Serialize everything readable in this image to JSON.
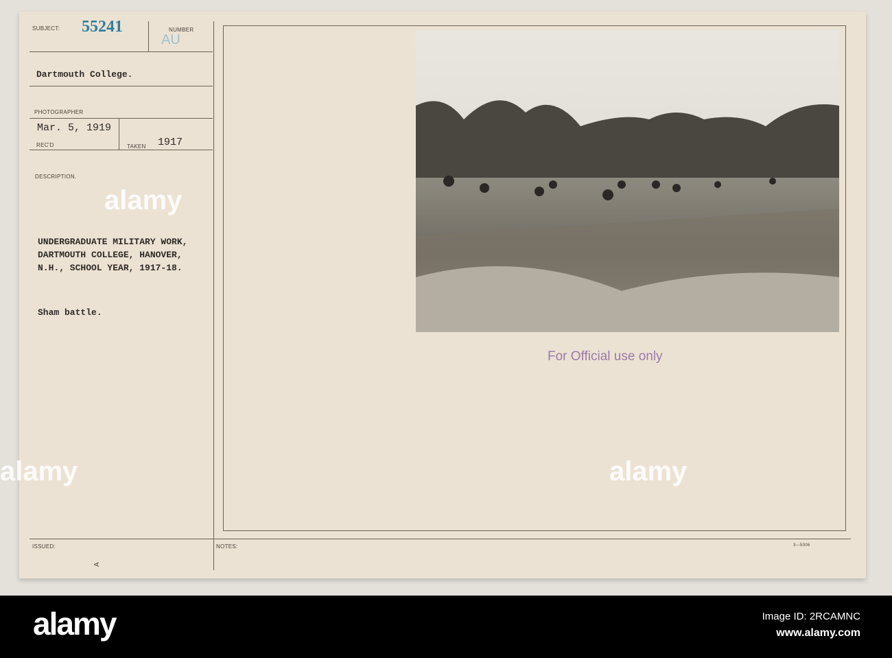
{
  "card": {
    "subject_label": "SUBJECT:",
    "subject_number": "55241",
    "number_label": "NUMBER",
    "number_value": "AU",
    "subject_text": "Dartmouth College.",
    "photographer_label": "PHOTOGRAPHER",
    "received_date": "Mar. 5, 1919",
    "recd_label": "REC'D",
    "taken_label": "TAKEN",
    "taken_year": "1917",
    "description_label": "DESCRIPTION.",
    "description_lines": [
      "UNDERGRADUATE MILITARY WORK,",
      "DARTMOUTH COLLEGE, HANOVER,",
      "N.H., SCHOOL YEAR, 1917-18."
    ],
    "caption": "Sham battle.",
    "stamp": "For Official use only",
    "issued_label": "ISSUED:",
    "notes_label": "NOTES:",
    "form_code": "3—5006",
    "issued_mark": "A"
  },
  "watermark": "alamy",
  "footer": {
    "logo": "alamy",
    "image_id": "Image ID: 2RCAMNC",
    "url": "www.alamy.com"
  },
  "colors": {
    "stamp": "#9a7aa8",
    "number": "#2f7f9e",
    "au": "#9cc4cc"
  }
}
